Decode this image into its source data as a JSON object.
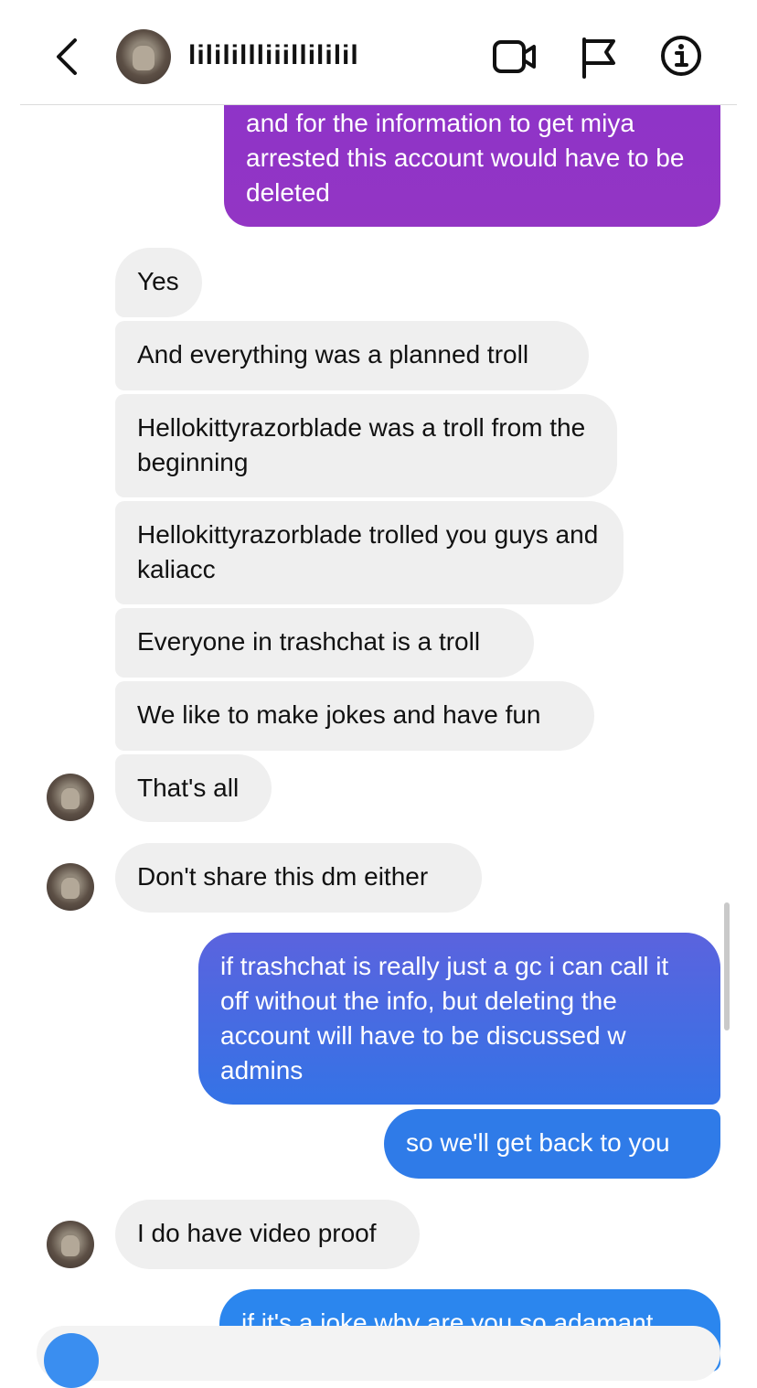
{
  "header": {
    "username": "lililillliiillililil",
    "icons": {
      "back": "chevron-left-icon",
      "video": "video-call-icon",
      "flag": "flag-icon",
      "info": "info-icon"
    }
  },
  "colors": {
    "incoming_bubble": "#efefef",
    "outgoing_purple": "#8e34c8",
    "outgoing_blue": "#2f7be8"
  },
  "messages": [
    {
      "from": "me",
      "text": "and for the information to get miya arrested this account would have to be deleted"
    },
    {
      "from": "them",
      "text": "Yes"
    },
    {
      "from": "them",
      "text": "And everything was a planned troll"
    },
    {
      "from": "them",
      "text": "Hellokittyrazorblade was a troll from the beginning"
    },
    {
      "from": "them",
      "text": "Hellokittyrazorblade trolled you guys and kaliacc"
    },
    {
      "from": "them",
      "text": "Everyone in trashchat is a troll"
    },
    {
      "from": "them",
      "text": "We like to make jokes and have fun"
    },
    {
      "from": "them",
      "text": "That's all"
    },
    {
      "from": "them",
      "text": "Don't share this dm either"
    },
    {
      "from": "me",
      "text": "if trashchat is really just a gc i can call it off without the info, but deleting the account will have to be discussed w admins"
    },
    {
      "from": "me",
      "text": "so we'll get back to you"
    },
    {
      "from": "them",
      "text": "I do have video proof"
    },
    {
      "from": "me",
      "text": "if it's a joke why are you so adamant"
    }
  ]
}
